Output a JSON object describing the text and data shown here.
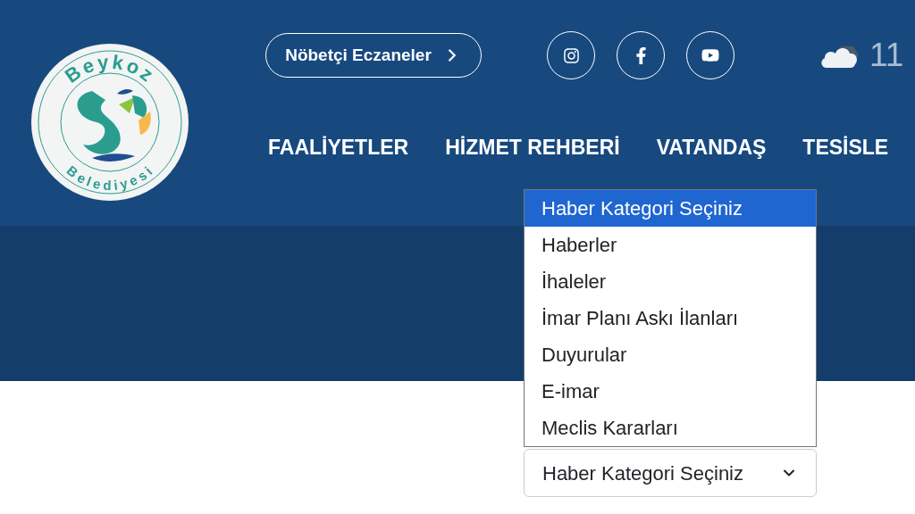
{
  "logo": {
    "top_text": "Beykoz",
    "bottom_text": "Belediyesi"
  },
  "top_bar": {
    "pharmacy_button": "Nöbetçi Eczaneler",
    "weather": {
      "temperature": "11"
    }
  },
  "social": [
    {
      "kind": "instagram"
    },
    {
      "kind": "facebook"
    },
    {
      "kind": "youtube"
    }
  ],
  "nav": [
    "FAALİYETLER",
    "HİZMET REHBERİ",
    "VATANDAŞ",
    "TESİSLE"
  ],
  "category_select": {
    "value": "Haber Kategori Seçiniz",
    "expanded": true,
    "options": [
      {
        "label": "Haber Kategori Seçiniz",
        "selected": true
      },
      {
        "label": "Haberler",
        "selected": false
      },
      {
        "label": "İhaleler",
        "selected": false
      },
      {
        "label": "İmar Planı Askı İlanları",
        "selected": false
      },
      {
        "label": "Duyurular",
        "selected": false
      },
      {
        "label": "E-imar",
        "selected": false
      },
      {
        "label": "Meclis Kararları",
        "selected": false
      }
    ]
  }
}
